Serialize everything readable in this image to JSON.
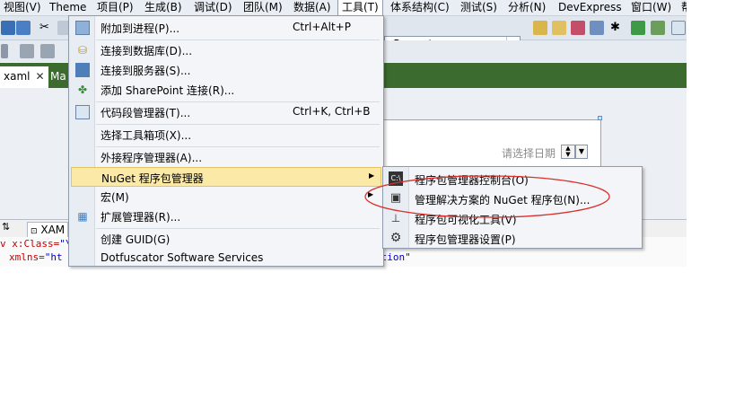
{
  "menubar": {
    "items": [
      "视图(V)",
      "Theme",
      "项目(P)",
      "生成(B)",
      "调试(D)",
      "团队(M)",
      "数据(A)",
      "工具(T)",
      "体系结构(C)",
      "测试(S)",
      "分析(N)",
      "DevExpress",
      "窗口(W)",
      "帮"
    ],
    "active": "工具(T)"
  },
  "toolbar": {
    "combo_value": "eProperty"
  },
  "tabs": {
    "items": [
      {
        "label": "xaml",
        "close": "✕"
      },
      {
        "label": "Ma"
      }
    ]
  },
  "designer": {
    "date_placeholder": "请选择日期",
    "xaml_tab": "XAM"
  },
  "code": {
    "line1_prefix": "v ",
    "line1_attr": "x:Class=",
    "line1_val": "\"\\",
    "line2_attr": "xmlns=",
    "line2_val": "\"ht",
    "line2_tail": "ation\""
  },
  "tools_menu": {
    "items": [
      {
        "label": "附加到进程(P)...",
        "shortcut": "Ctrl+Alt+P",
        "icon": "attach-process-icon"
      },
      {
        "label": "连接到数据库(D)...",
        "icon": "connect-database-icon"
      },
      {
        "label": "连接到服务器(S)...",
        "icon": "connect-server-icon"
      },
      {
        "label": "添加 SharePoint 连接(R)...",
        "icon": "sharepoint-icon"
      },
      {
        "label": "代码段管理器(T)...",
        "shortcut": "Ctrl+K, Ctrl+B",
        "icon": "snippet-manager-icon"
      },
      {
        "label": "选择工具箱项(X)..."
      },
      {
        "label": "外接程序管理器(A)..."
      },
      {
        "label": "NuGet 程序包管理器",
        "submenu": true
      },
      {
        "label": "宏(M)",
        "submenu": true
      },
      {
        "label": "扩展管理器(R)...",
        "icon": "extension-manager-icon"
      },
      {
        "label": "创建 GUID(G)"
      },
      {
        "label": "Dotfuscator Software Services"
      }
    ]
  },
  "nuget_submenu": {
    "items": [
      {
        "label": "程序包管理器控制台(O)",
        "icon": "console-icon"
      },
      {
        "label": "管理解决方案的 NuGet 程序包(N)...",
        "icon": "package-icon"
      },
      {
        "label": "程序包可视化工具(V)",
        "icon": "hierarchy-icon"
      },
      {
        "label": "程序包管理器设置(P)",
        "icon": "gear-icon"
      }
    ]
  },
  "colors": {
    "tab_strip": "#3b6b2f",
    "menu_highlight": "#fbe9a8",
    "annotation": "#d9302c"
  }
}
